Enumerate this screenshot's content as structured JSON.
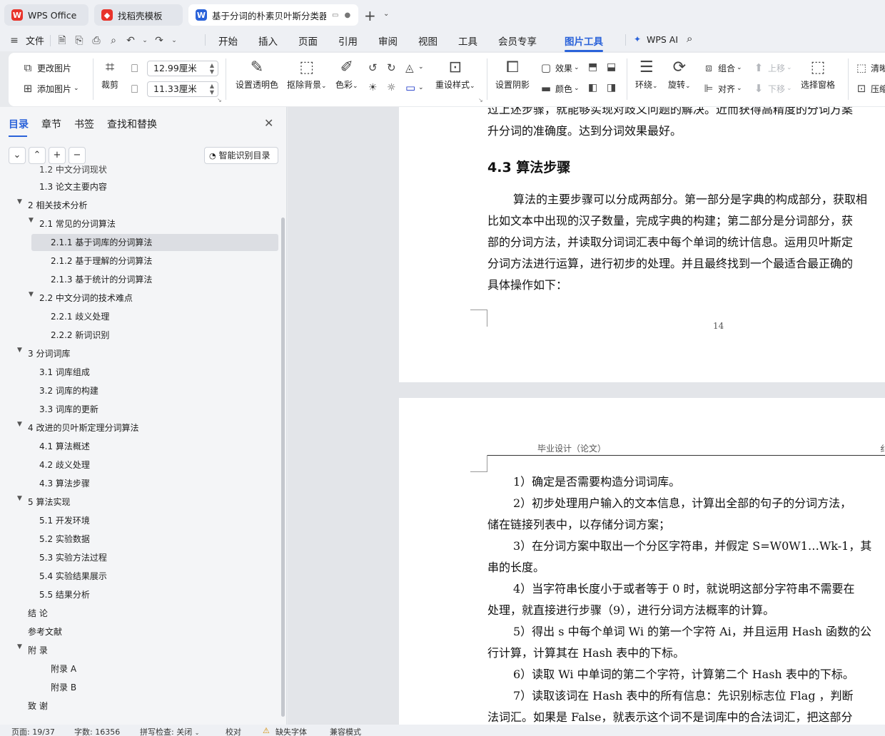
{
  "tabs": [
    {
      "label": "WPS Office"
    },
    {
      "label": "找稻壳模板"
    },
    {
      "label": "基于分词的朴素贝叶斯分类器"
    }
  ],
  "menu": {
    "file": "文件",
    "items": [
      "开始",
      "插入",
      "页面",
      "引用",
      "审阅",
      "视图",
      "工具",
      "会员专享",
      "图片工具",
      "WPS AI"
    ]
  },
  "ribbon": {
    "change_image": "更改图片",
    "add_image": "添加图片",
    "crop": "裁剪",
    "width": "12.99厘米",
    "height": "11.33厘米",
    "transparent": "设置透明色",
    "remove_bg": "抠除背景",
    "color": "色彩",
    "reset_style": "重设样式",
    "shadow": "设置阴影",
    "effect": "效果",
    "fill_color": "颜色",
    "wrap": "环绕",
    "rotate": "旋转",
    "group": "组合",
    "align": "对齐",
    "up": "上移",
    "down": "下移",
    "select_pane": "选择窗格",
    "clear": "清晰",
    "compress": "压缩"
  },
  "panel": {
    "tabs": [
      "目录",
      "章节",
      "书签",
      "查找和替换"
    ],
    "smart_btn": "智能识别目录",
    "toc": [
      "1.2 中文分词现状",
      "1.3 论文主要内容",
      "2 相关技术分析",
      "2.1 常见的分词算法",
      "2.1.1 基于词库的分词算法",
      "2.1.2 基于理解的分词算法",
      "2.1.3 基于统计的分词算法",
      "2.2 中文分词的技术难点",
      "2.2.1 歧义处理",
      "2.2.2 新词识别",
      "3 分词词库",
      "3.1 词库组成",
      "3.2 词库的构建",
      "3.3 词库的更新",
      "4 改进的贝叶斯定理分词算法",
      "4.1 算法概述",
      "4.2 歧义处理",
      "4.3 算法步骤",
      "5 算法实现",
      "5.1 开发环境",
      "5.2 实验数据",
      "5.3 实验方法过程",
      "5.4 实验结果展示",
      "5.5 结果分析",
      "结 论",
      "参考文献",
      "附 录",
      "附录 A",
      "附录 B",
      "致 谢"
    ]
  },
  "doc": {
    "page1": {
      "line_top": "过上述步骤，就能够实现对歧义问题的解决。近而获得高精度的分词方案",
      "line2": "升分词的准确度。达到分词效果最好。",
      "heading": "4.3  算法步骤",
      "para": [
        "算法的主要步骤可以分成两部分。第一部分是字典的构成部分，获取相",
        "比如文本中出现的汉子数量，完成字典的构建；第二部分是分词部分，获",
        "部的分词方法，并读取分词词汇表中每个单词的统计信息。运用贝叶斯定",
        "分词方法进行运算，进行初步的处理。并且最终找到一个最适合最正确的",
        "具体操作如下："
      ],
      "page_number": "14"
    },
    "page2": {
      "header": "毕业设计（论文）",
      "header_right": "纟",
      "lines": [
        "1）确定是否需要构造分词词库。",
        "2）初步处理用户输入的文本信息，计算出全部的句子的分词方法，",
        "储在链接列表中，以存储分词方案；",
        "3）在分词方案中取出一个分区字符串，并假定 S=W0W1…Wk-1，其",
        "串的长度。",
        "4）当字符串长度小于或者等于 0 时，就说明这部分字符串不需要在",
        "处理，就直接进行步骤（9），进行分词方法概率的计算。",
        "5）得出 s 中每个单词 Wi 的第一个字符 Ai，并且运用 Hash 函数的公",
        "行计算，计算其在 Hash 表中的下标。",
        "6）读取 Wi 中单词的第二个字符，计算第二个 Hash 表中的下标。",
        "7）读取该词在 Hash 表中的所有信息：先识别标志位 Flag ，判断",
        "法词汇。如果是 False，就表示这个词不是词库中的合法词汇，把这部分"
      ]
    }
  },
  "status": {
    "page": "页面: 19/37",
    "words": "字数: 16356",
    "spell": "拼写检查: 关闭",
    "proof": "校对",
    "missing_font": "缺失字体",
    "compat": "兼容模式"
  },
  "colors": {
    "accent": "#2a62d9",
    "wps_red": "#e8332a"
  }
}
